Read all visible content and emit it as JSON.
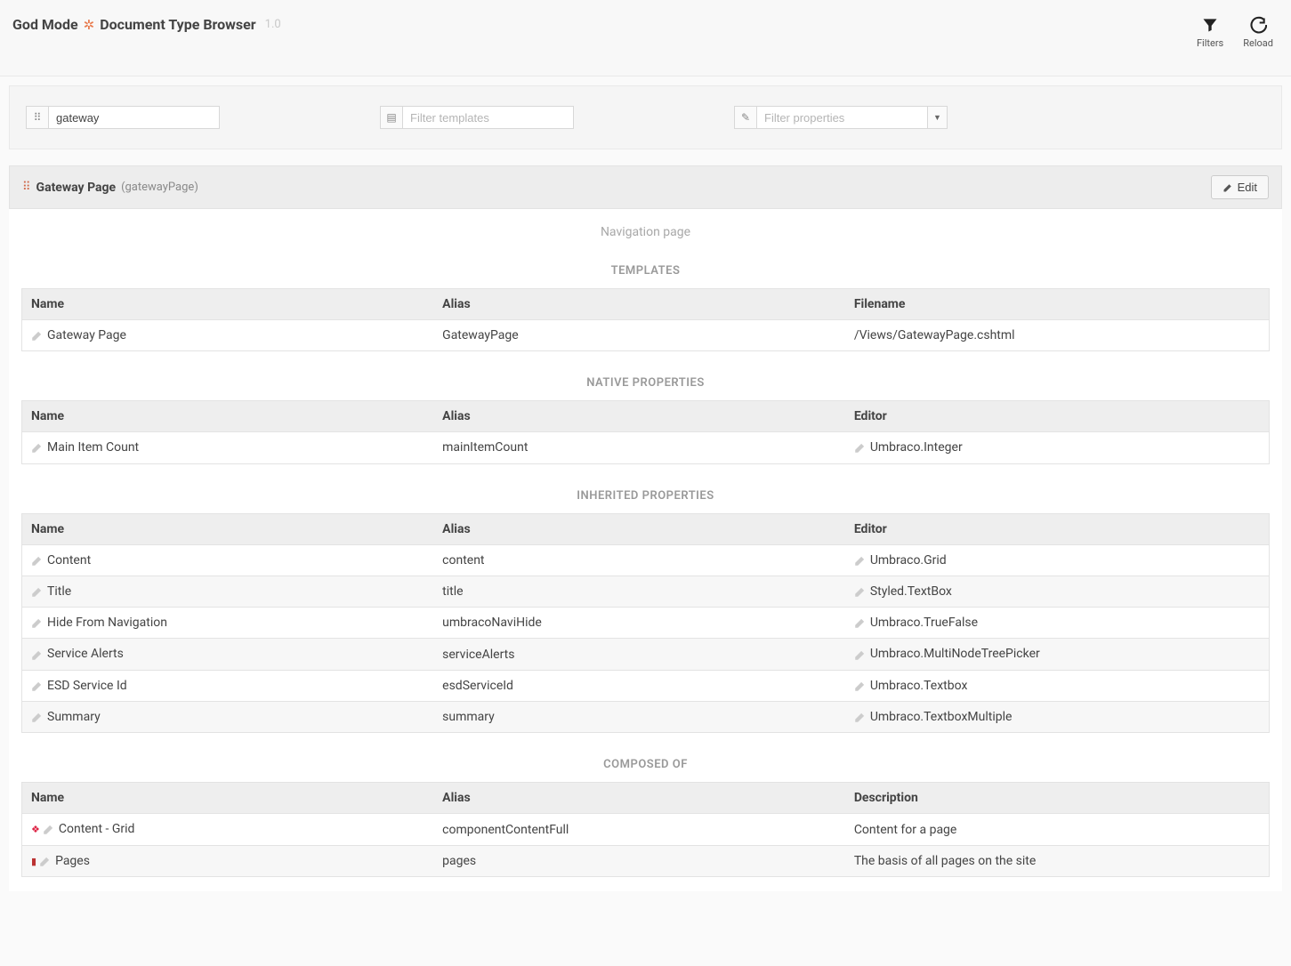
{
  "header": {
    "title1": "God Mode",
    "title2": "Document Type Browser",
    "version": "1.0",
    "filters_label": "Filters",
    "reload_label": "Reload"
  },
  "filters": {
    "doctype_value": "gateway",
    "template_placeholder": "Filter templates",
    "property_placeholder": "Filter properties"
  },
  "doc": {
    "icon": "⠿",
    "title": "Gateway Page",
    "alias": "(gatewayPage)",
    "edit_label": "Edit",
    "description": "Navigation page"
  },
  "sections": {
    "templates_title": "TEMPLATES",
    "native_title": "NATIVE PROPERTIES",
    "inherited_title": "INHERITED PROPERTIES",
    "composed_title": "COMPOSED OF"
  },
  "templates": {
    "headers": {
      "name": "Name",
      "alias": "Alias",
      "filename": "Filename"
    },
    "rows": [
      {
        "name": "Gateway Page",
        "alias": "GatewayPage",
        "filename": "/Views/GatewayPage.cshtml"
      }
    ]
  },
  "native": {
    "headers": {
      "name": "Name",
      "alias": "Alias",
      "editor": "Editor"
    },
    "rows": [
      {
        "name": "Main Item Count",
        "alias": "mainItemCount",
        "editor": "Umbraco.Integer"
      }
    ]
  },
  "inherited": {
    "headers": {
      "name": "Name",
      "alias": "Alias",
      "editor": "Editor"
    },
    "rows": [
      {
        "name": "Content",
        "alias": "content",
        "editor": "Umbraco.Grid"
      },
      {
        "name": "Title",
        "alias": "title",
        "editor": "Styled.TextBox"
      },
      {
        "name": "Hide From Navigation",
        "alias": "umbracoNaviHide",
        "editor": "Umbraco.TrueFalse"
      },
      {
        "name": "Service Alerts",
        "alias": "serviceAlerts",
        "editor": "Umbraco.MultiNodeTreePicker"
      },
      {
        "name": "ESD Service Id",
        "alias": "esdServiceId",
        "editor": "Umbraco.Textbox"
      },
      {
        "name": "Summary",
        "alias": "summary",
        "editor": "Umbraco.TextboxMultiple"
      }
    ]
  },
  "composed": {
    "headers": {
      "name": "Name",
      "alias": "Alias",
      "description": "Description"
    },
    "rows": [
      {
        "iconclass": "compose-icon-red",
        "icon": "❖",
        "name": "Content - Grid",
        "alias": "componentContentFull",
        "description": "Content for a page"
      },
      {
        "iconclass": "compose-icon-dark",
        "icon": "▮",
        "name": "Pages",
        "alias": "pages",
        "description": "The basis of all pages on the site"
      }
    ]
  }
}
